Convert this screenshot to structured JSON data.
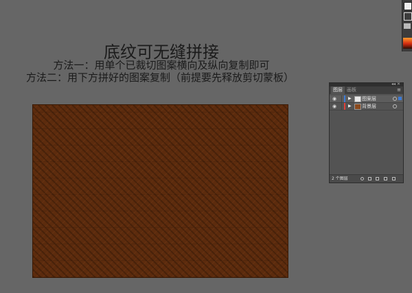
{
  "heading": {
    "title": "底纹可无缝拼接",
    "method1": "方法一：用单个已裁切图案横向及纵向复制即可",
    "method2": "方法二：用下方拼好的图案复制（前提要先释放剪切蒙板）"
  },
  "canvas": {
    "pattern_color": "#5c2b0d",
    "border_color": "#3a1a05"
  },
  "tools": {
    "icons": [
      "selection-tool-icon",
      "frame-tool-icon",
      "artboard-tool-icon",
      "gradient-swatch-icon"
    ]
  },
  "layers_panel": {
    "tabs": [
      {
        "label": "图层",
        "active": true
      },
      {
        "label": "画板",
        "active": false
      }
    ],
    "menu_glyph": "≡",
    "collapse_glyph": "◂◂ ✕",
    "layers": [
      {
        "name": "图案层",
        "color": "#3d7bd6",
        "thumb": "#e8e8e8",
        "selected": true
      },
      {
        "name": "背景层",
        "color": "#e0403a",
        "thumb": "#8a4a1e",
        "selected": false
      }
    ],
    "footer": {
      "count": "2 个图层"
    }
  }
}
